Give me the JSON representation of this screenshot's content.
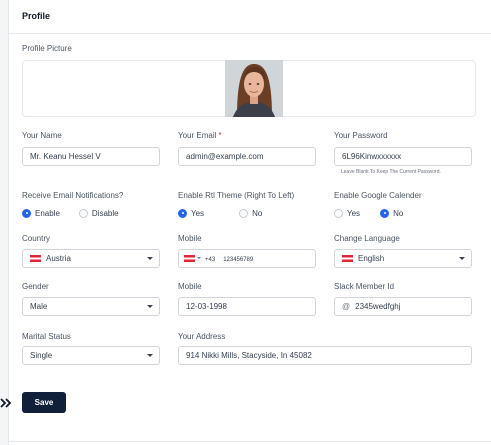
{
  "card": {
    "title": "Profile"
  },
  "profile_picture": {
    "label": "Profile Picture"
  },
  "fields": {
    "name": {
      "label": "Your Name",
      "value": "Mr. Keanu Hessel V"
    },
    "email": {
      "label": "Your Email",
      "required": "*",
      "value": "admin@example.com"
    },
    "password": {
      "label": "Your Password",
      "value": "6L96Kinwxxxxxx",
      "hint": "Leave Blank To Keep The Current Password."
    },
    "email_notifications": {
      "label": "Receive Email Notifications?",
      "options": [
        "Enable",
        "Disable"
      ],
      "selected": "Enable"
    },
    "rtl_theme": {
      "label": "Enable Rtl Theme (Right To Left)",
      "options": [
        "Yes",
        "No"
      ],
      "selected": "Yes"
    },
    "google_calendar": {
      "label": "Enable Google Calender",
      "options": [
        "Yes",
        "No"
      ],
      "selected": "No"
    },
    "country": {
      "label": "Country",
      "value": "Austria"
    },
    "mobile": {
      "label": "Mobile",
      "dial_code": "+43",
      "number": "123456789"
    },
    "language": {
      "label": "Change Language",
      "value": "English"
    },
    "gender": {
      "label": "Gender",
      "value": "Male"
    },
    "dob": {
      "label": "Mobile",
      "value": "12-03-1998"
    },
    "slack": {
      "label": "Slack Member Id",
      "prefix": "@",
      "value": "2345wedfghj"
    },
    "marital_status": {
      "label": "Marital Status",
      "value": "Single"
    },
    "address": {
      "label": "Your Address",
      "value": "914 Nikki Mills, Stacyside, In 45082"
    }
  },
  "actions": {
    "save_label": "Save"
  },
  "colors": {
    "primary_button": "#101f3a",
    "radio_selected": "#2563eb",
    "required": "#dc2626"
  },
  "icons": {
    "flag": "austria-flag-icon",
    "caret": "chevron-down-icon",
    "arrows": "double-chevron-right-icon"
  }
}
